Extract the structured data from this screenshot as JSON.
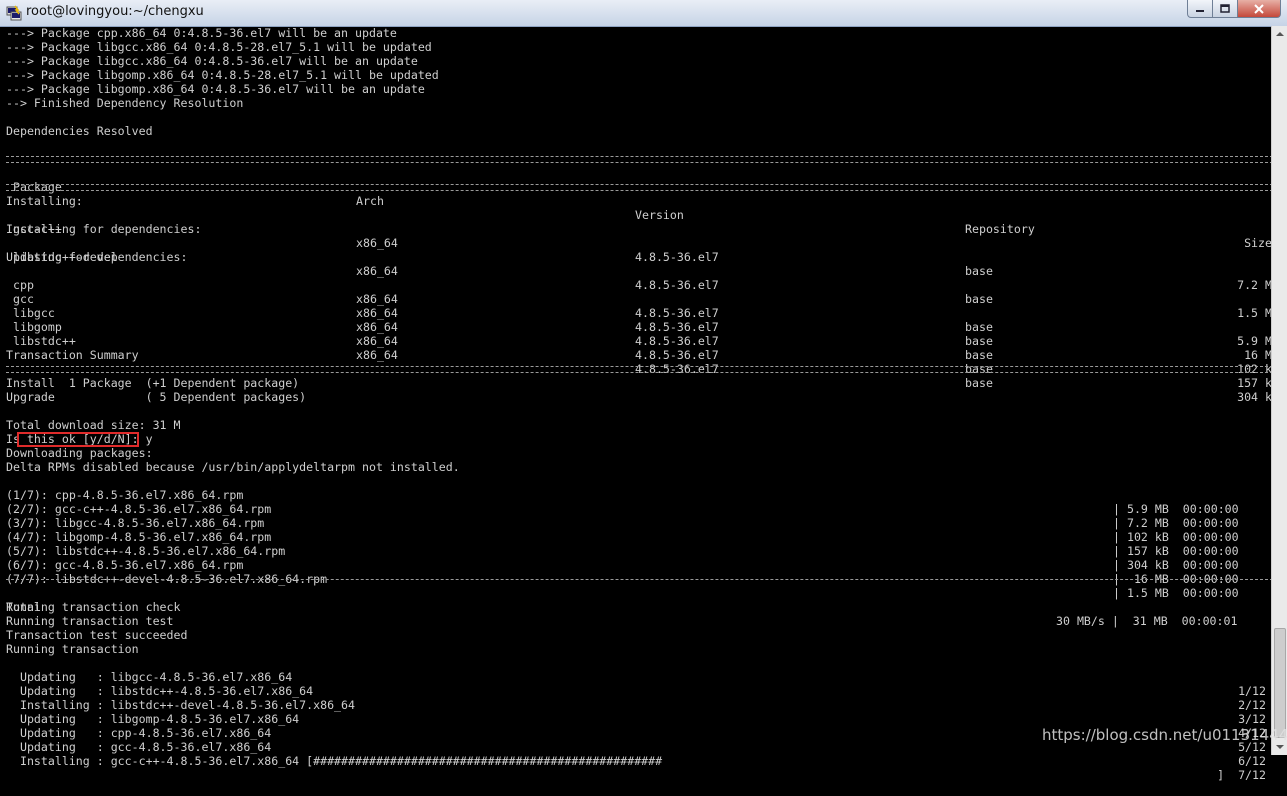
{
  "window": {
    "title": "root@lovingyou:~/chengxu"
  },
  "terminal": {
    "pre_lines": [
      "---> Package cpp.x86_64 0:4.8.5-36.el7 will be an update",
      "---> Package libgcc.x86_64 0:4.8.5-28.el7_5.1 will be updated",
      "---> Package libgcc.x86_64 0:4.8.5-36.el7 will be an update",
      "---> Package libgomp.x86_64 0:4.8.5-28.el7_5.1 will be updated",
      "---> Package libgomp.x86_64 0:4.8.5-36.el7 will be an update",
      "--> Finished Dependency Resolution",
      "",
      "Dependencies Resolved"
    ],
    "table": {
      "headers": [
        "Package",
        "Arch",
        "Version",
        "Repository",
        "Size"
      ],
      "rows": [
        {
          "type": "section",
          "text": "Installing:"
        },
        {
          "type": "pkg",
          "cells": [
            " gcc-c++",
            "x86_64",
            "4.8.5-36.el7",
            "base",
            "7.2 M"
          ]
        },
        {
          "type": "section",
          "text": "Installing for dependencies:"
        },
        {
          "type": "pkg",
          "cells": [
            " libstdc++-devel",
            "x86_64",
            "4.8.5-36.el7",
            "base",
            "1.5 M"
          ]
        },
        {
          "type": "section",
          "text": "Updating for dependencies:"
        },
        {
          "type": "pkg",
          "cells": [
            " cpp",
            "x86_64",
            "4.8.5-36.el7",
            "base",
            "5.9 M"
          ]
        },
        {
          "type": "pkg",
          "cells": [
            " gcc",
            "x86_64",
            "4.8.5-36.el7",
            "base",
            "16 M"
          ]
        },
        {
          "type": "pkg",
          "cells": [
            " libgcc",
            "x86_64",
            "4.8.5-36.el7",
            "base",
            "102 k"
          ]
        },
        {
          "type": "pkg",
          "cells": [
            " libgomp",
            "x86_64",
            "4.8.5-36.el7",
            "base",
            "157 k"
          ]
        },
        {
          "type": "pkg",
          "cells": [
            " libstdc++",
            "x86_64",
            "4.8.5-36.el7",
            "base",
            "304 k"
          ]
        }
      ]
    },
    "summary_title": "Transaction Summary",
    "summary_lines": [
      "Install  1 Package  (+1 Dependent package)",
      "Upgrade             ( 5 Dependent packages)"
    ],
    "download_size": "Total download size: 31 M",
    "prompt_line": "Is this ok [y/d/N]: y",
    "download_header": [
      "Downloading packages:",
      "Delta RPMs disabled because /usr/bin/applydeltarpm not installed."
    ],
    "downloads": [
      {
        "name": "(1/7): cpp-4.8.5-36.el7.x86_64.rpm",
        "size": "| 5.9 MB  00:00:00"
      },
      {
        "name": "(2/7): gcc-c++-4.8.5-36.el7.x86_64.rpm",
        "size": "| 7.2 MB  00:00:00"
      },
      {
        "name": "(3/7): libgcc-4.8.5-36.el7.x86_64.rpm",
        "size": "| 102 kB  00:00:00"
      },
      {
        "name": "(4/7): libgomp-4.8.5-36.el7.x86_64.rpm",
        "size": "| 157 kB  00:00:00"
      },
      {
        "name": "(5/7): libstdc++-4.8.5-36.el7.x86_64.rpm",
        "size": "| 304 kB  00:00:00"
      },
      {
        "name": "(6/7): gcc-4.8.5-36.el7.x86_64.rpm",
        "size": "|  16 MB  00:00:00"
      },
      {
        "name": "(7/7): libstdc++-devel-4.8.5-36.el7.x86_64.rpm",
        "size": "| 1.5 MB  00:00:00"
      }
    ],
    "total": {
      "label": "Total",
      "stats": "30 MB/s |  31 MB  00:00:01"
    },
    "transaction_lines": [
      "Running transaction check",
      "Running transaction test",
      "Transaction test succeeded",
      "Running transaction"
    ],
    "steps": [
      {
        "text": "  Updating   : libgcc-4.8.5-36.el7.x86_64",
        "count": "1/12"
      },
      {
        "text": "  Updating   : libstdc++-4.8.5-36.el7.x86_64",
        "count": "2/12"
      },
      {
        "text": "  Installing : libstdc++-devel-4.8.5-36.el7.x86_64",
        "count": "3/12"
      },
      {
        "text": "  Updating   : libgomp-4.8.5-36.el7.x86_64",
        "count": "4/12"
      },
      {
        "text": "  Updating   : cpp-4.8.5-36.el7.x86_64",
        "count": "5/12"
      },
      {
        "text": "  Updating   : gcc-4.8.5-36.el7.x86_64",
        "count": "6/12"
      },
      {
        "text": "  Installing : gcc-c++-4.8.5-36.el7.x86_64 [##################################################",
        "count": "]  7/12"
      }
    ]
  },
  "watermark": "https://blog.csdn.net/u011314442",
  "icons": {
    "app": "putty-icon",
    "minimize": "minimize-icon",
    "maximize": "maximize-icon",
    "close": "close-icon"
  },
  "colors": {
    "terminal_bg": "#000000",
    "terminal_fg": "#cfcfcf",
    "highlight": "#e02b2b"
  }
}
